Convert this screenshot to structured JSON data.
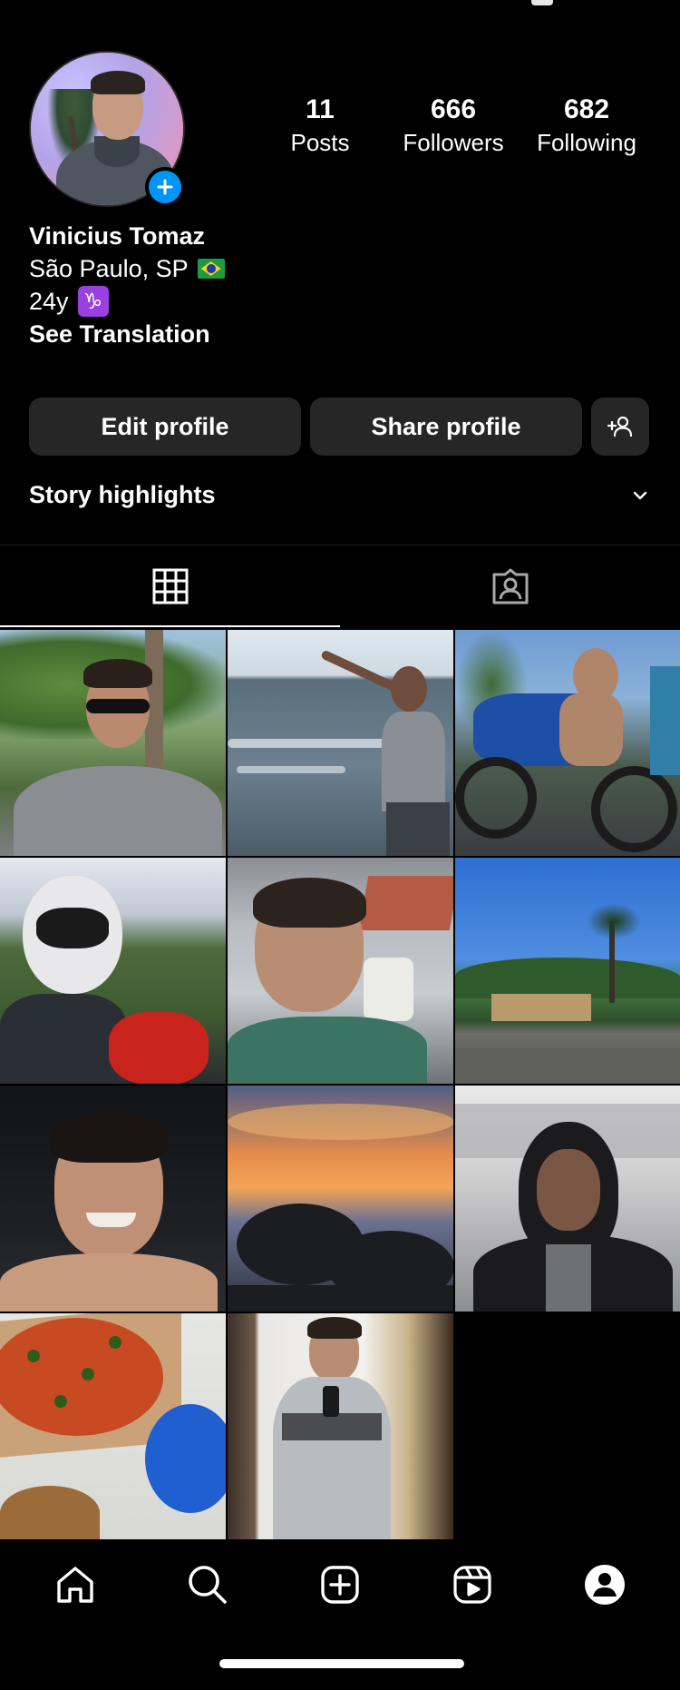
{
  "profile": {
    "name": "Vinicius Tomaz",
    "location": "São Paulo, SP",
    "age": "24y",
    "zodiac_glyph": "♑",
    "see_translation": "See Translation",
    "add_story_icon": "plus-icon"
  },
  "stats": {
    "posts": {
      "count": "11",
      "label": "Posts"
    },
    "followers": {
      "count": "666",
      "label": "Followers"
    },
    "following": {
      "count": "682",
      "label": "Following"
    }
  },
  "actions": {
    "edit_label": "Edit profile",
    "share_label": "Share profile",
    "discover_icon": "add-person-icon"
  },
  "highlights": {
    "title": "Story highlights",
    "toggle_icon": "chevron-down-icon"
  },
  "tabs": [
    {
      "icon": "grid-icon",
      "active": true
    },
    {
      "icon": "tagged-icon",
      "active": false
    }
  ],
  "posts": [
    {
      "subject": "selfie-sunglasses-trees"
    },
    {
      "subject": "beach-waves-pointing"
    },
    {
      "subject": "motorcycle-blue"
    },
    {
      "subject": "helmet-selfie-motorbike"
    },
    {
      "subject": "drinking-glass-profile"
    },
    {
      "subject": "palm-tree-road-blue-sky"
    },
    {
      "subject": "smiling-portrait-dark"
    },
    {
      "subject": "sunset-clouds-trees"
    },
    {
      "subject": "hoodie-portrait-graffiti"
    },
    {
      "subject": "pizza-and-dog"
    },
    {
      "subject": "mirror-selfie-hoodie"
    }
  ],
  "bottom_nav": [
    {
      "icon": "home-icon"
    },
    {
      "icon": "search-icon"
    },
    {
      "icon": "create-icon"
    },
    {
      "icon": "reels-icon"
    },
    {
      "icon": "profile-icon"
    }
  ],
  "colors": {
    "background": "#000000",
    "button": "#262626",
    "accent_blue": "#0095f6"
  }
}
